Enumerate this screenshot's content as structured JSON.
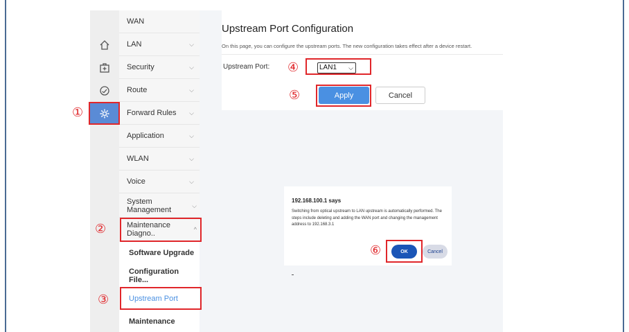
{
  "sidebar_icons": [
    {
      "name": "home-icon"
    },
    {
      "name": "medkit-icon"
    },
    {
      "name": "gauge-icon"
    },
    {
      "name": "gear-icon",
      "active": true
    }
  ],
  "menu": {
    "items": [
      {
        "label": "WAN",
        "chevron": ""
      },
      {
        "label": "LAN",
        "chevron": "⌵"
      },
      {
        "label": "Security",
        "chevron": "⌵"
      },
      {
        "label": "Route",
        "chevron": "⌵"
      },
      {
        "label": "Forward Rules",
        "chevron": "⌵"
      },
      {
        "label": "Application",
        "chevron": "⌵"
      },
      {
        "label": "WLAN",
        "chevron": "⌵"
      },
      {
        "label": "Voice",
        "chevron": "⌵"
      },
      {
        "label": "System Management",
        "chevron": "⌵"
      },
      {
        "label": "Maintenance Diagno..",
        "chevron": "^"
      }
    ],
    "subitems": [
      {
        "label": "Software Upgrade"
      },
      {
        "label": "Configuration File..."
      },
      {
        "label": "Upstream Port"
      },
      {
        "label": "Maintenance"
      }
    ]
  },
  "page": {
    "title": "Upstream Port Configuration",
    "description": "On this page, you can configure the upstream ports. The new configuration takes effect after a device restart.",
    "field_label": "Upstream Port:",
    "select_value": "LAN1",
    "apply_label": "Apply",
    "cancel_label": "Cancel"
  },
  "dialog": {
    "title": "192.168.100.1 says",
    "message": "Switching from optical upstream to LAN upstream is automatically performed. The steps include deleting and adding the WAN port and changing the management address to 192.168.3.1",
    "ok_label": "OK",
    "cancel_label": "Cancel"
  },
  "steps": [
    "①",
    "②",
    "③",
    "④",
    "⑤",
    "⑥"
  ],
  "colors": {
    "accent": "#4a90e2",
    "highlight": "#e0262a",
    "dialog_ok": "#1a55b7"
  }
}
